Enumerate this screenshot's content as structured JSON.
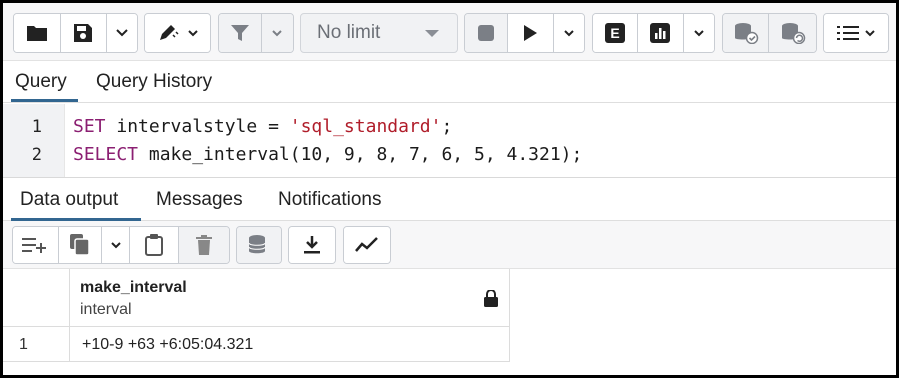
{
  "toolbar": {
    "limit_select": "No limit",
    "icons": [
      "folder-icon",
      "save-icon",
      "edit-icon",
      "filter-icon",
      "stop-icon",
      "execute-icon",
      "explain-icon",
      "explain-analyze-icon",
      "commit-icon",
      "rollback-icon",
      "macros-icon"
    ],
    "explain_letter": "E"
  },
  "query_tabs": [
    {
      "label": "Query",
      "active": true
    },
    {
      "label": "Query History",
      "active": false
    }
  ],
  "editor": {
    "lines": [
      {
        "num": "1",
        "keyword": "SET",
        "text": " intervalstyle = ",
        "string": "'sql_standard'",
        "tail": ";"
      },
      {
        "num": "2",
        "keyword": "SELECT",
        "text": " make_interval(10, 9, 8, 7, 6, 5, 4.321);"
      }
    ]
  },
  "result_tabs": [
    {
      "label": "Data output",
      "active": true
    },
    {
      "label": "Messages",
      "active": false
    },
    {
      "label": "Notifications",
      "active": false
    }
  ],
  "result_table": {
    "columns": [
      {
        "name": "make_interval",
        "type": "interval",
        "locked": true
      }
    ],
    "rows": [
      {
        "num": "1",
        "values": [
          "+10-9 +63 +6:05:04.321"
        ]
      }
    ]
  },
  "colors": {
    "accent": "#326690",
    "keyword": "#8b1f72",
    "string": "#b01d2a"
  }
}
